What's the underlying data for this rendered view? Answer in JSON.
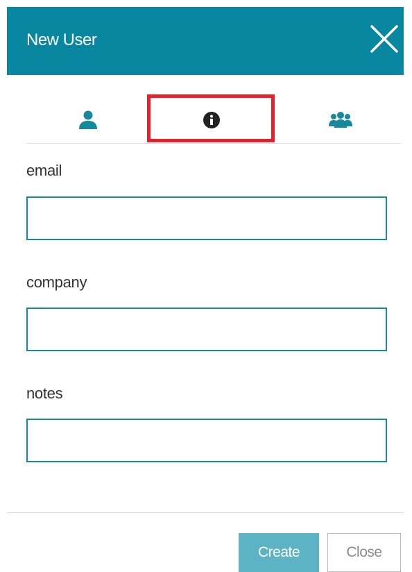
{
  "dialog": {
    "title": "New User",
    "close_icon": "close-icon"
  },
  "tabs": [
    {
      "icon": "user-icon",
      "active": false,
      "color": "#168a9c"
    },
    {
      "icon": "info-circle-icon",
      "active": true,
      "color": "#222222"
    },
    {
      "icon": "user-group-icon",
      "active": false,
      "color": "#168a9c"
    }
  ],
  "form": {
    "email": {
      "label": "email",
      "value": ""
    },
    "company": {
      "label": "company",
      "value": ""
    },
    "notes": {
      "label": "notes",
      "value": ""
    }
  },
  "footer": {
    "create_label": "Create",
    "close_label": "Close"
  },
  "colors": {
    "header": "#0a87a0",
    "accent": "#168a9c",
    "create_button": "#5cb3c3",
    "highlight": "#e5232c"
  }
}
